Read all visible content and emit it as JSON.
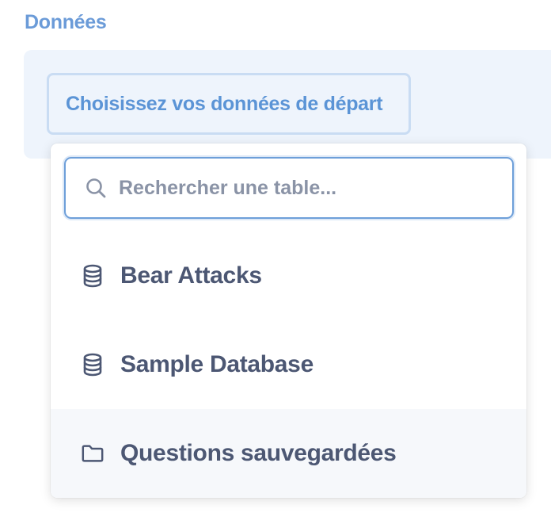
{
  "section": {
    "label": "Données"
  },
  "data_step": {
    "pick_label": "Choisissez vos données de départ"
  },
  "picker": {
    "search_placeholder": "Rechercher une table...",
    "items": [
      {
        "label": "Bear Attacks",
        "icon": "database-icon"
      },
      {
        "label": "Sample Database",
        "icon": "database-icon"
      },
      {
        "label": "Questions sauvegardées",
        "icon": "folder-icon"
      }
    ]
  },
  "colors": {
    "accent": "#509ee3",
    "label_blue": "#6b9bd8",
    "panel_bg": "#eef4fc",
    "text_dark": "#4c5773"
  }
}
